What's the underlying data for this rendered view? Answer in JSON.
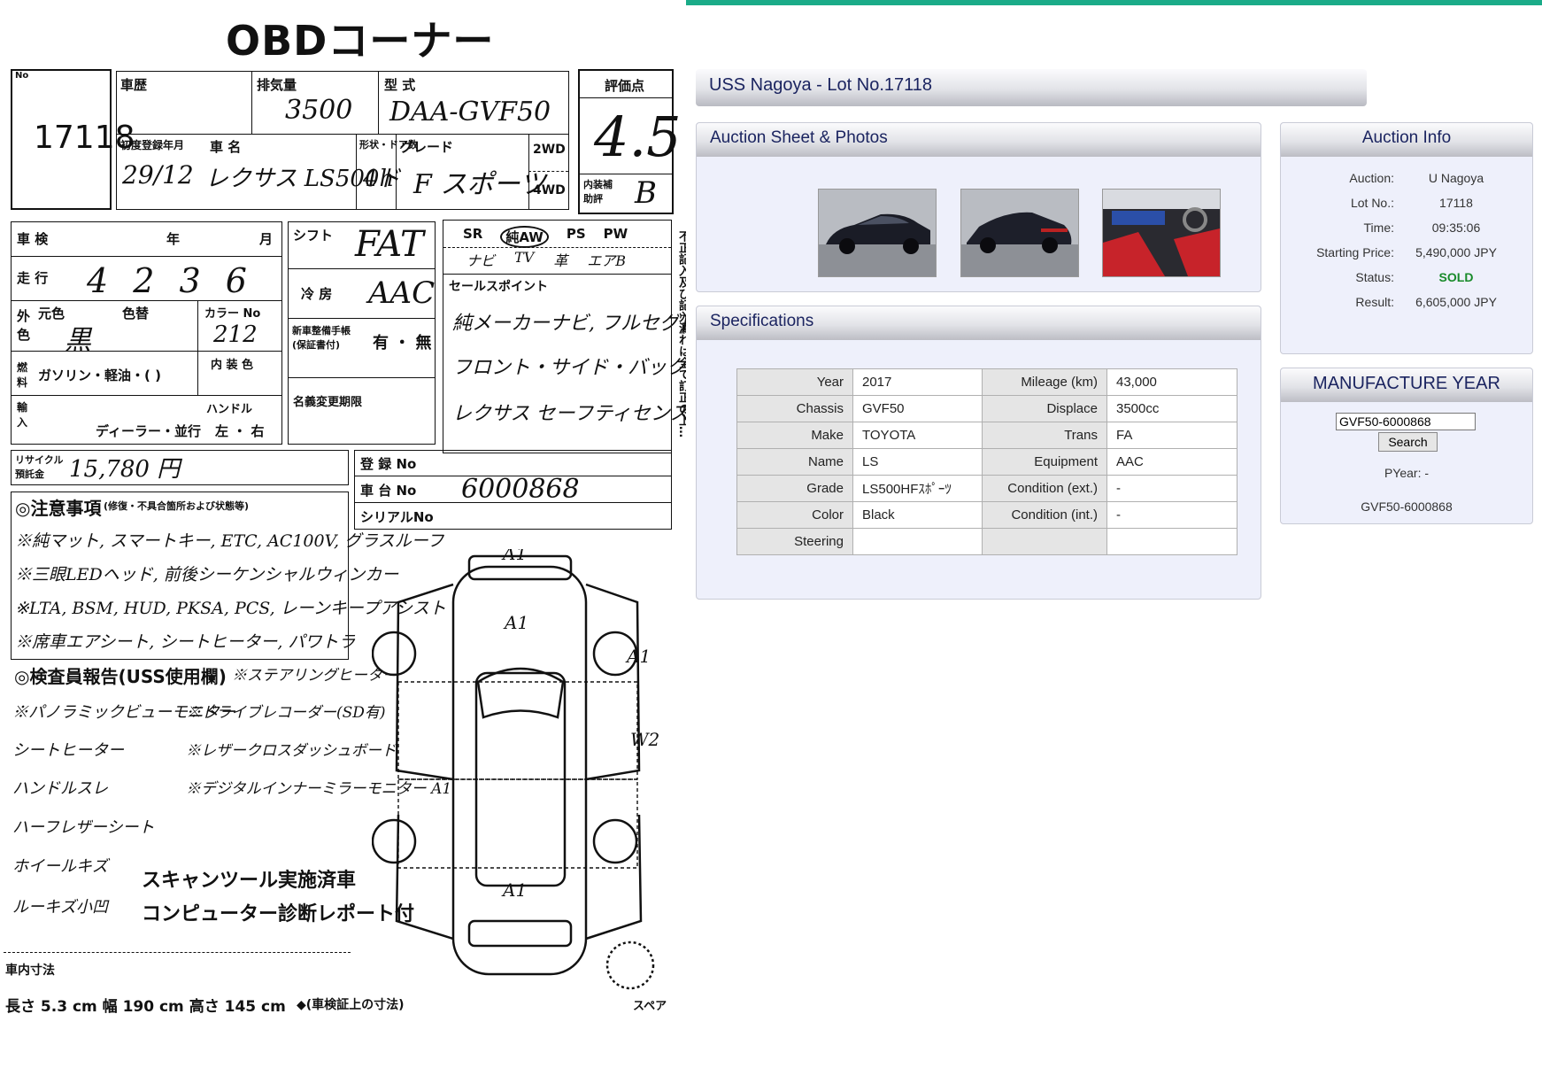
{
  "page": {
    "title": "USS Nagoya - Lot No.17118"
  },
  "sheet_panel": {
    "title": "Auction Sheet & Photos",
    "photos": [
      "car-front-side-photo",
      "car-rear-side-photo",
      "car-interior-photo"
    ]
  },
  "sheet": {
    "header": "OBDコーナー",
    "lot_no": "17118",
    "history_label": "車歴",
    "displacement_label": "排気量",
    "displacement": "3500",
    "model_label": "型 式",
    "model": "DAA-GVF50",
    "score_label": "評価点",
    "score": "4.5",
    "reg_label": "初度登録年月",
    "reg_date": "29/12",
    "name_label": "車 名",
    "name": "レクサス LS500h",
    "doors_label": "形状・ドア数",
    "doors": "4ド",
    "grade_label": "グレード",
    "grade": "F スポーツ",
    "drive_2wd": "2WD",
    "drive_4wd": "4WD",
    "int_score_label": "内装補助評",
    "int_score": "B",
    "shaken_label": "車 検",
    "year_label": "年",
    "month_label": "月",
    "shift_label": "シフト",
    "shift": "FAT",
    "mileage_label": "走 行",
    "mileage": "4 2 3 6",
    "ac_label": "冷 房",
    "ac": "AAC",
    "color_label": "外色",
    "color_orig_label": "元色",
    "color_orig": "黒",
    "color_change_label": "色替",
    "color_no_label": "カラー No",
    "color_no": "212",
    "fuel_label": "燃料",
    "fuel": "ガソリン・軽油・(   )",
    "int_color_label": "内 装 色",
    "warranty_label": "新車整備手帳(保証書付)",
    "warranty": "有 ・ 無",
    "import_label": "輸入",
    "dealer": "ディーラー・並行",
    "handle_label": "ハンドル",
    "handle": "左 ・ 右",
    "name_change_label": "名義変更期限",
    "equip_row1": [
      "SR",
      "純AW",
      "PS",
      "PW"
    ],
    "equip_row2": [
      "ナビ",
      "TV",
      "革",
      "エアB"
    ],
    "sales_label": "セールスポイント",
    "sales_points": [
      "純メーカーナビ, フルセグTV",
      "フロント・サイド・バックモニター",
      "レクサス セーフティセンス"
    ],
    "recycle_label": "リサイクル預託金",
    "recycle_amount": "15,780 円",
    "reg_no_label": "登 録 No",
    "chassis_no_label": "車 台 No",
    "chassis_no": "6000868",
    "serial_label": "シリアルNo",
    "notes_label": "◎注意事項",
    "notes_sub": "(修復・不具合箇所および状態等)",
    "notes": [
      "※純マット, スマートキー, ETC, AC100V, グラスルーフ",
      "※三眼LEDヘッド, 前後シーケンシャルウィンカー",
      "※LTA, BSM, HUD, PKSA, PCS, レーンキープアシスト",
      "※席車エアシート, シートヒーター, パワトラ"
    ],
    "inspector_label": "◎検査員報告(USS使用欄)",
    "inspector_left": [
      "※パノラミックビューモニター",
      "シートヒーター",
      "ハンドルスレ",
      "ハーフレザーシート",
      "ホイールキズ",
      "ルーキズ小凹"
    ],
    "inspector_right": [
      "※ステアリングヒーター",
      "※ドライブレコーダー(SD有)",
      "※レザークロスダッシュボード",
      "※デジタルインナーミラーモニター A1"
    ],
    "scan_notes": [
      "スキャンツール実施済車",
      "コンピューター診断レポート付"
    ],
    "dims_label": "車内寸法",
    "dims": "長さ 5.3 cm  幅 190 cm  高さ 145 cm",
    "dims_note": "◆(車検証上の寸法)",
    "map_marks": [
      "A1",
      "A1",
      "A1",
      "W2",
      "A1"
    ],
    "spare_label": "スペア",
    "side_note": "不正記入及び記入漏れは全て訂正の上…"
  },
  "specs": {
    "title": "Specifications",
    "rows": [
      [
        "Year",
        "2017",
        "Mileage (km)",
        "43,000"
      ],
      [
        "Chassis",
        "GVF50",
        "Displace",
        "3500cc"
      ],
      [
        "Make",
        "TOYOTA",
        "Trans",
        "FA"
      ],
      [
        "Name",
        "LS",
        "Equipment",
        "AAC"
      ],
      [
        "Grade",
        "LS500HFｽﾎﾟｰﾂ",
        "Condition (ext.)",
        "-"
      ],
      [
        "Color",
        "Black",
        "Condition (int.)",
        "-"
      ],
      [
        "Steering",
        "",
        "",
        ""
      ]
    ]
  },
  "auction_info": {
    "title": "Auction Info",
    "rows": [
      {
        "k": "Auction:",
        "v": "U Nagoya"
      },
      {
        "k": "Lot No.:",
        "v": "17118"
      },
      {
        "k": "Time:",
        "v": "09:35:06"
      },
      {
        "k": "Starting Price:",
        "v": "5,490,000 JPY"
      },
      {
        "k": "Status:",
        "v": "SOLD"
      },
      {
        "k": "Result:",
        "v": "6,605,000 JPY"
      }
    ],
    "status_color": "#188a2a"
  },
  "manufacture": {
    "title": "MANUFACTURE YEAR",
    "input_value": "GVF50-6000868",
    "search_label": "Search",
    "pyear": "PYear: -",
    "result": "GVF50-6000868"
  },
  "colors": {
    "accent": "#1aab88",
    "heading": "#1b2460",
    "panel_bg": "#eef0fb"
  }
}
